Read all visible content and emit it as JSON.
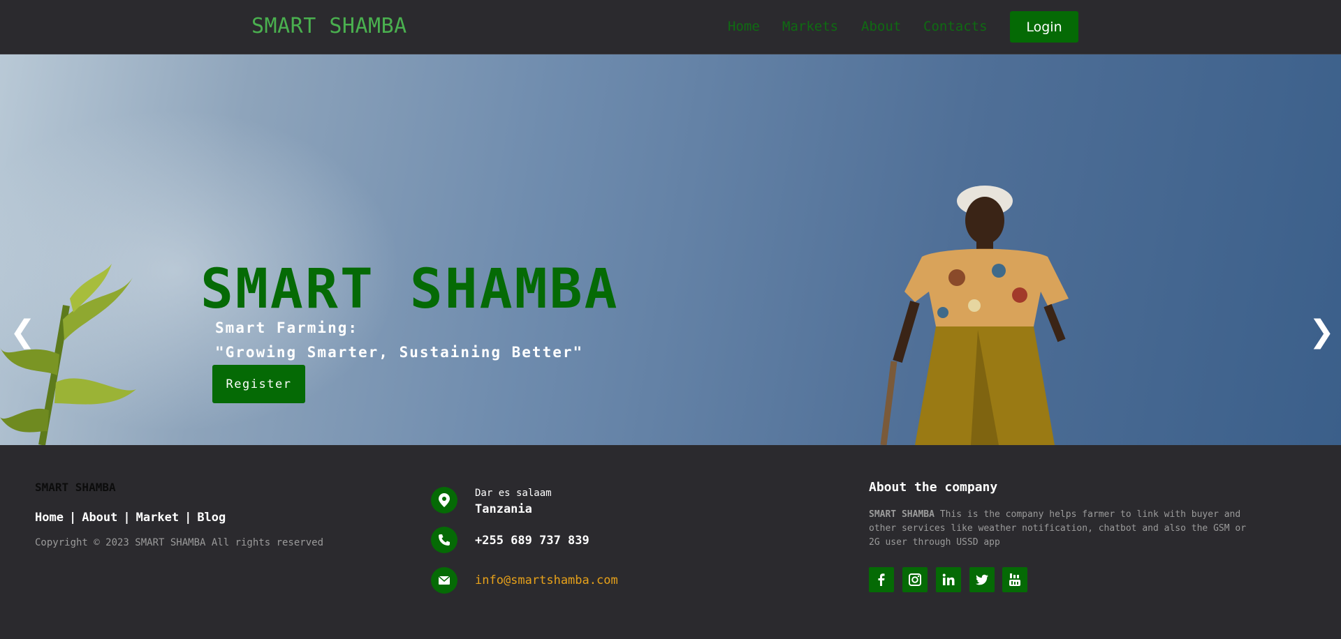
{
  "header": {
    "brand": "SMART SHAMBA",
    "nav": [
      "Home",
      "Markets",
      "About",
      "Contacts"
    ],
    "login_label": "Login"
  },
  "hero": {
    "title": "SMART SHAMBA",
    "subtitle_line1": "Smart Farming:",
    "subtitle_line2": "\"Growing Smarter, Sustaining Better\"",
    "register_label": "Register",
    "prev_arrow": "❮",
    "next_arrow": "❯"
  },
  "footer": {
    "brand": "SMART SHAMBA",
    "links": [
      "Home",
      "About",
      "Market",
      "Blog"
    ],
    "copyright": "Copyright © 2023 SMART SHAMBA All rights reserved",
    "address_line1": "Dar es salaam",
    "address_line2": "Tanzania",
    "phone": "+255 689 737 839",
    "email": "info@smartshamba.com",
    "about_title": "About the company",
    "about_brand": "SMART SHAMBA",
    "about_text": " This is the company helps farmer to link with buyer and other services like weather notification, chatbot and also the GSM or 2G user through USSD app",
    "social": [
      "facebook-icon",
      "instagram-icon",
      "linkedin-icon",
      "twitter-icon",
      "youtube-icon"
    ]
  },
  "colors": {
    "background": "#2b2a2e",
    "accent_green": "#056a05",
    "brand_green": "#4ab04f",
    "email_orange": "#e8a21a"
  }
}
